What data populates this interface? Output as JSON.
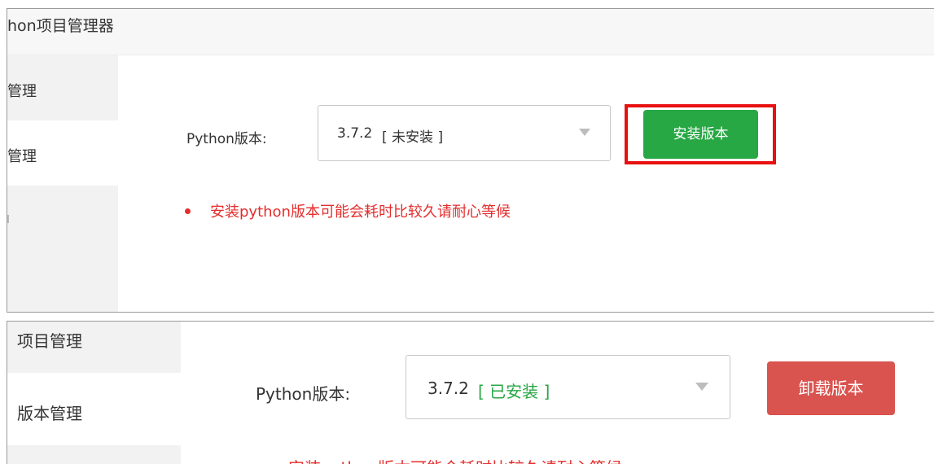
{
  "panel_top": {
    "title": "hon项目管理器",
    "sidebar": [
      {
        "label": "管理"
      },
      {
        "label": "管理"
      }
    ],
    "version_label": "Python版本:",
    "select": {
      "version": "3.7.2",
      "status": "[ 未安装 ]"
    },
    "install_button": "安装版本",
    "note": "安装python版本可能会耗时比较久请耐心等候"
  },
  "panel_bottom": {
    "sidebar": [
      {
        "label": "项目管理"
      },
      {
        "label": "版本管理"
      }
    ],
    "version_label": "Python版本:",
    "select": {
      "version": "3.7.2",
      "status": "[ 已安装 ]"
    },
    "uninstall_button": "卸载版本",
    "note": "安装python版本可能会耗时比较久请耐心等候"
  },
  "colors": {
    "install_button": "#28a745",
    "uninstall_button": "#d9534f",
    "highlight_border": "#e81010",
    "note_text": "#e42d2d",
    "installed_status": "#28a745"
  }
}
